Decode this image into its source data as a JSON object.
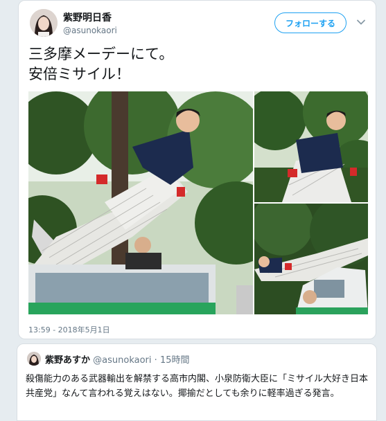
{
  "tweet": {
    "display_name": "紫野明日香",
    "handle": "@asunokaori",
    "follow_label": "フォローする",
    "text_line1": "三多摩メーデーにて。",
    "text_line2": "安倍ミサイル！",
    "timestamp": "13:59 - 2018年5月1日"
  },
  "reply": {
    "display_name": "紫野あすか",
    "handle": "@asunokaori",
    "separator": "·",
    "time_ago": "15時間",
    "text": "殺傷能力のある武器輸出を解禁する高市内閣、小泉防衛大臣に「ミサイル大好き日本共産党」なんて言われる覚えはない。揶揄だとしても余りに軽率過ぎる発言。"
  },
  "colors": {
    "accent": "#1da1f2",
    "muted": "#657786",
    "background": "#e6ecf0"
  }
}
